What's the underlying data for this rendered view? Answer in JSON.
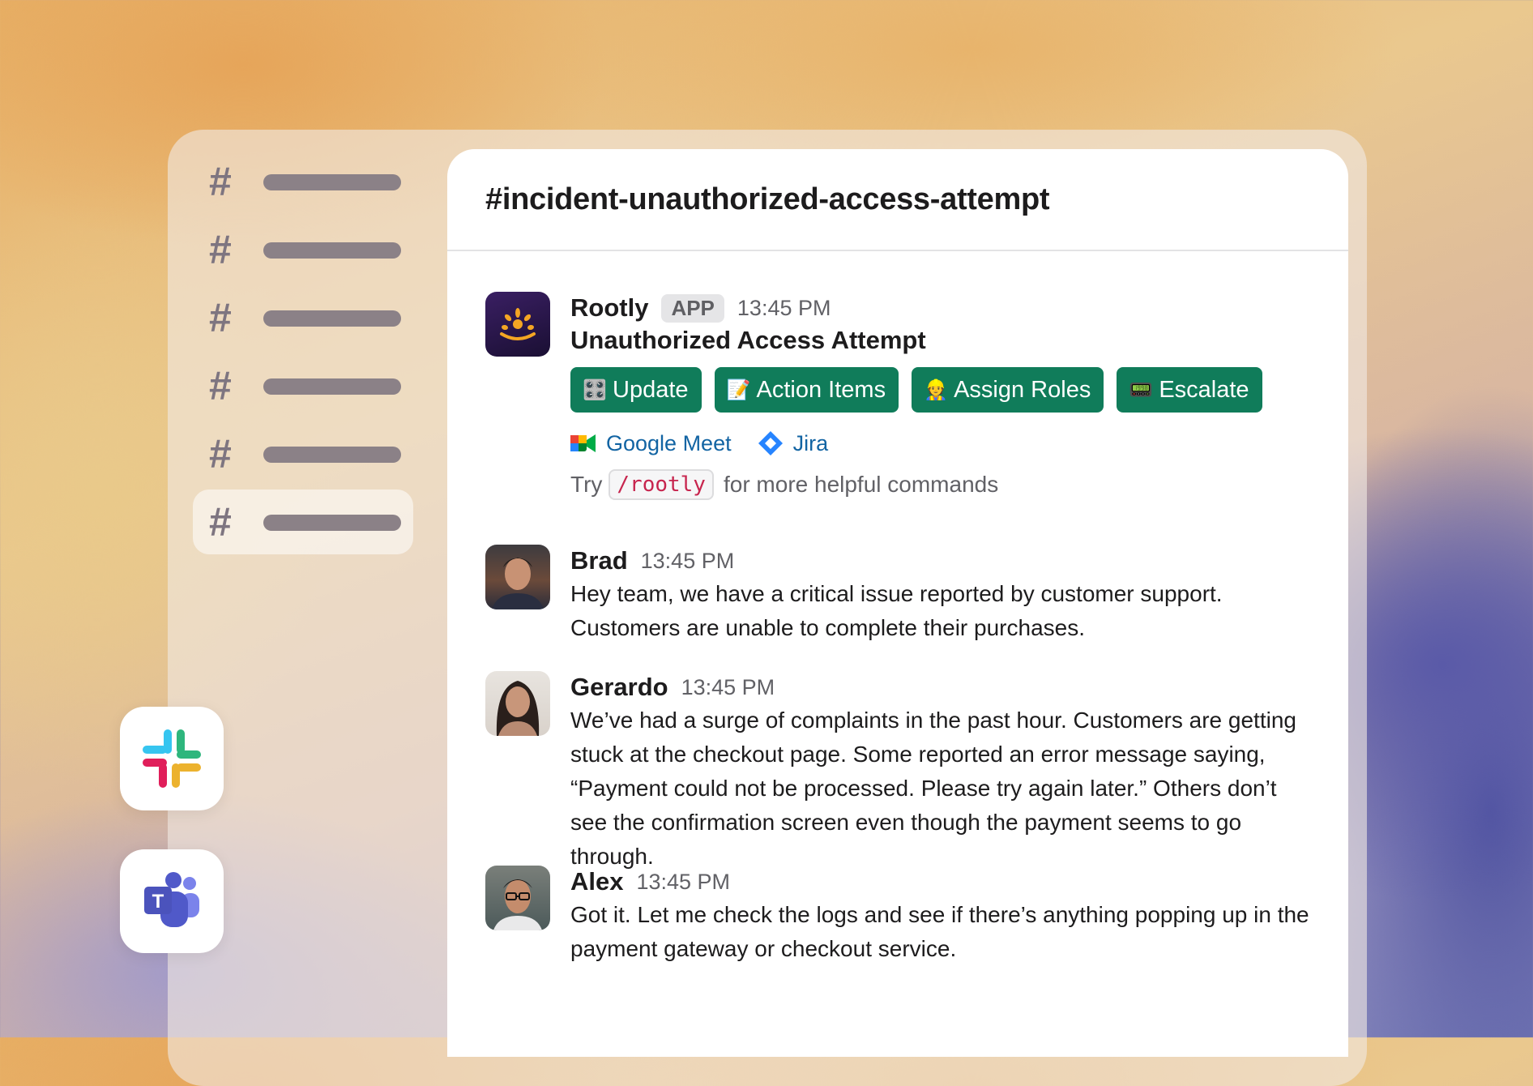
{
  "sidebar": {
    "channels": [
      {
        "icon": "#"
      },
      {
        "icon": "#"
      },
      {
        "icon": "#"
      },
      {
        "icon": "#"
      },
      {
        "icon": "#"
      },
      {
        "icon": "#",
        "active": true
      }
    ],
    "apps": [
      "slack-logo",
      "microsoft-teams-logo"
    ]
  },
  "channel": {
    "title": "#incident-unauthorized-access-attempt"
  },
  "messages": [
    {
      "author": "Rootly",
      "badge": "APP",
      "time": "13:45 PM",
      "subject": "Unauthorized Access Attempt",
      "buttons": [
        {
          "label": "Update",
          "emoji": "🎛️"
        },
        {
          "label": "Action Items",
          "emoji": "📝"
        },
        {
          "label": "Assign Roles",
          "emoji": "👷"
        },
        {
          "label": "Escalate",
          "emoji": "📟"
        }
      ],
      "links": [
        {
          "label": "Google Meet",
          "icon": "google-meet-icon"
        },
        {
          "label": "Jira",
          "icon": "jira-icon"
        }
      ],
      "hint_prefix": "Try",
      "hint_command": "/rootly",
      "hint_suffix": "for more helpful commands"
    },
    {
      "author": "Brad",
      "time": "13:45 PM",
      "text": "Hey team, we have a critical issue reported by customer support. Customers are unable to complete their purchases."
    },
    {
      "author": "Gerardo",
      "time": "13:45 PM",
      "text": "We’ve had a surge of complaints in the past hour. Customers are getting stuck at the checkout page. Some reported an error message saying, “Payment could not be processed. Please try again later.” Others don’t see the confirmation screen even though the payment seems to go through."
    },
    {
      "author": "Alex",
      "time": "13:45 PM",
      "text": "Got it. Let me check the logs and see if there’s anything popping up in the payment gateway or checkout service."
    }
  ],
  "colors": {
    "button": "#107c5a",
    "link": "#1264a3",
    "code": "#c7254e",
    "rootly_bg": "#2a1a4a",
    "rootly_accent": "#f4a623"
  }
}
